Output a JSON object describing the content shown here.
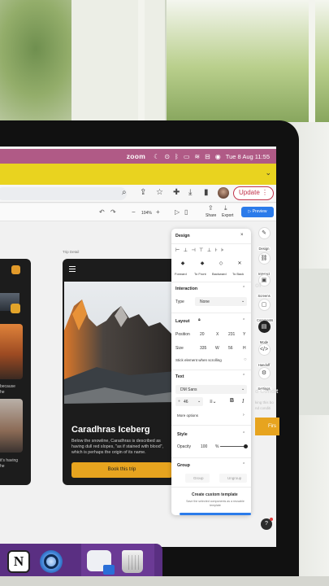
{
  "menubar": {
    "app": "zoom",
    "datetime": "Tue 8 Aug  11:55",
    "color": "#b05a86"
  },
  "browser": {
    "update_label": "Update",
    "more_icon": "vertical-dots-icon"
  },
  "app_toolbar": {
    "zoom": "104%",
    "share_label": "Share",
    "export_label": "Export",
    "preview_label": "Preview"
  },
  "canvas": {
    "frame_label": "Trip Detail",
    "left_card_texts": [
      "because",
      "he",
      "it's having",
      "he"
    ],
    "trip": {
      "title": "Caradhras Iceberg",
      "description": "Below the snowline, Caradhras is described as having dull red slopes, \"as if stained with blood\", which is perhaps the origin of its name.",
      "button": "Book this trip"
    },
    "accent": "#e7a41f"
  },
  "design_panel": {
    "title": "Design",
    "layer_actions": [
      "Forward",
      "To Front",
      "Backward",
      "To Back"
    ],
    "interaction": {
      "header": "Interaction",
      "type_label": "Type",
      "type_value": "None"
    },
    "layout": {
      "header": "Layout",
      "position_label": "Position",
      "pos_x": "20",
      "x_label": "X",
      "pos_y": "231",
      "y_label": "Y",
      "size_label": "Size",
      "width": "335",
      "w_label": "W",
      "height": "56",
      "h_label": "H",
      "sticky_label": "Stick element when scrolling"
    },
    "text": {
      "header": "Text",
      "font": "DM Sans",
      "font_size": "46",
      "bold": "B",
      "italic": "I",
      "more_options": "More options"
    },
    "style": {
      "header": "Style",
      "opacity_label": "Opacity",
      "opacity_value": "100",
      "opacity_unit": "%",
      "opacity_fraction": 1.0
    },
    "group": {
      "header": "Group",
      "group_label": "Group",
      "ungroup_label": "Ungroup"
    },
    "template": {
      "title": "Create custom template",
      "subtitle": "Save the selected components as a reusable template"
    }
  },
  "right_rail": [
    {
      "label": "Design",
      "icon": "pen-icon"
    },
    {
      "label": "Interact",
      "icon": "link-icon"
    },
    {
      "label": "Screens",
      "icon": "screens-icon"
    },
    {
      "label": "Comments",
      "icon": "comment-icon"
    },
    {
      "label": "Mode",
      "icon": "mode-icon"
    },
    {
      "label": "Handoff",
      "icon": "code-icon"
    },
    {
      "label": "Settings",
      "icon": "gear-icon"
    }
  ],
  "partial_page": {
    "line1": "of",
    "line2": "d Condit",
    "line3": "king this bo",
    "line4": "nd conditi",
    "button": "Firs"
  },
  "help": "?",
  "dock": {
    "notion_letter": "N"
  }
}
